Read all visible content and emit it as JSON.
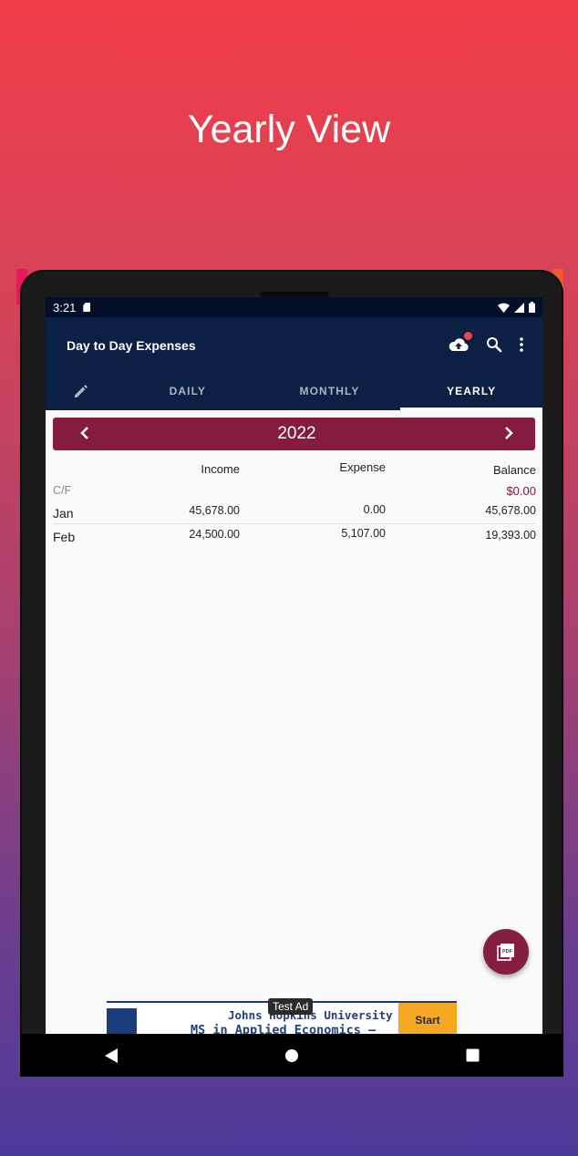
{
  "promo": {
    "title": "Yearly View"
  },
  "status": {
    "time": "3:21"
  },
  "app": {
    "title": "Day to Day Expenses"
  },
  "tabs": [
    {
      "label": "DAILY",
      "active": false
    },
    {
      "label": "MONTHLY",
      "active": false
    },
    {
      "label": "YEARLY",
      "active": true
    }
  ],
  "year": {
    "label": "2022"
  },
  "table": {
    "headers": {
      "income": "Income",
      "expense": "Expense",
      "balance": "Balance"
    },
    "carry_forward": {
      "label": "C/F",
      "balance": "$0.00"
    },
    "rows": [
      {
        "month": "Jan",
        "income": "45,678.00",
        "expense": "0.00",
        "balance": "45,678.00"
      },
      {
        "month": "Feb",
        "income": "24,500.00",
        "expense": "5,107.00",
        "balance": "19,393.00"
      }
    ]
  },
  "fab": {
    "icon": "pdf-icon"
  },
  "ad": {
    "tag": "Test Ad",
    "line1": "Johns Hopkins University",
    "line2": "MS in Applied Economics —",
    "cta": "Start"
  },
  "colors": {
    "appbar": "#0b2044",
    "accent": "#851c3e",
    "notification_dot": "#ef4545"
  }
}
